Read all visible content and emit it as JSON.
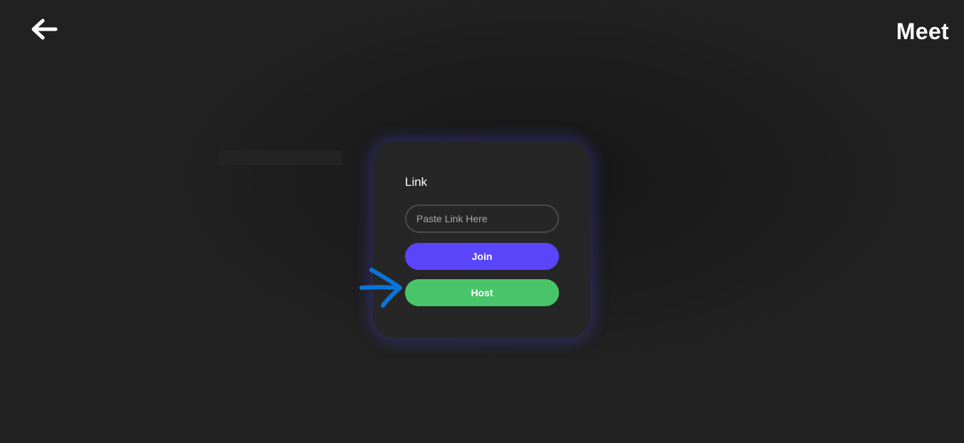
{
  "header": {
    "back_icon": "arrow-left-icon",
    "title": "Meet"
  },
  "card": {
    "label": "Link",
    "link_input": {
      "value": "",
      "placeholder": "Paste Link Here"
    },
    "join_label": "Join",
    "host_label": "Host"
  },
  "annotation": {
    "icon": "arrow-right-annotation-icon",
    "color": "#0a74d8"
  },
  "colors": {
    "background": "#212121",
    "card": "#262626",
    "join": "#5a45fa",
    "host": "#48c569",
    "glow": "#5848f0"
  }
}
